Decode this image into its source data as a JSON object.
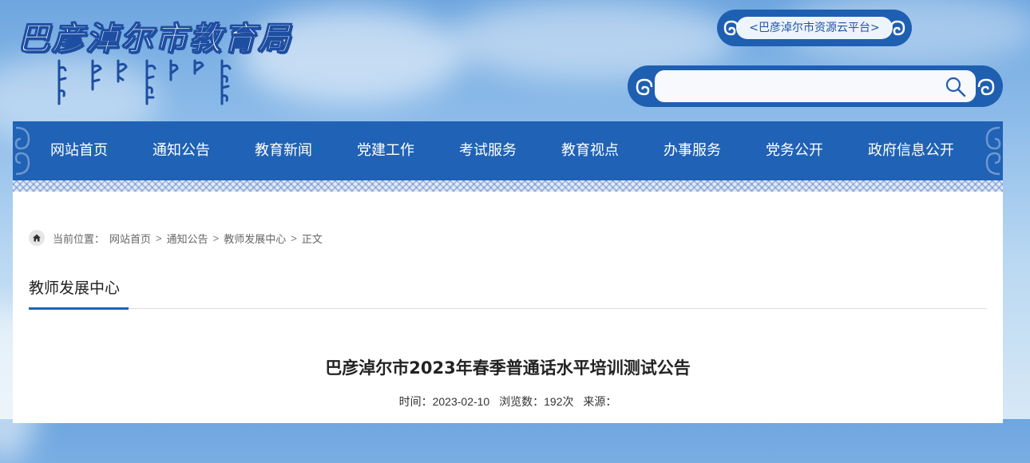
{
  "header": {
    "site_title": "巴彦淖尔市教育局",
    "cloud_platform": "<巴彦淖尔市资源云平台>"
  },
  "search": {
    "placeholder": "",
    "value": ""
  },
  "nav": {
    "items": [
      "网站首页",
      "通知公告",
      "教育新闻",
      "党建工作",
      "考试服务",
      "教育视点",
      "办事服务",
      "党务公开",
      "政府信息公开"
    ]
  },
  "breadcrumb": {
    "prefix": "当前位置：",
    "items": [
      "网站首页",
      "通知公告",
      "教师发展中心",
      "正文"
    ],
    "separator": ">"
  },
  "section": {
    "title": "教师发展中心"
  },
  "article": {
    "title": "巴彦淖尔市2023年春季普通话水平培训测试公告",
    "time_label": "时间：2023-02-10",
    "views_label": "浏览数：192次",
    "source_label": "来源："
  },
  "icons": {
    "search": "search-icon",
    "home": "home-icon",
    "ornament": "mongolian-ornament-icon"
  },
  "colors": {
    "brand_blue": "#2062b5",
    "title_stroke": "#1e4ea1",
    "page_bg": "#8fbdea"
  }
}
